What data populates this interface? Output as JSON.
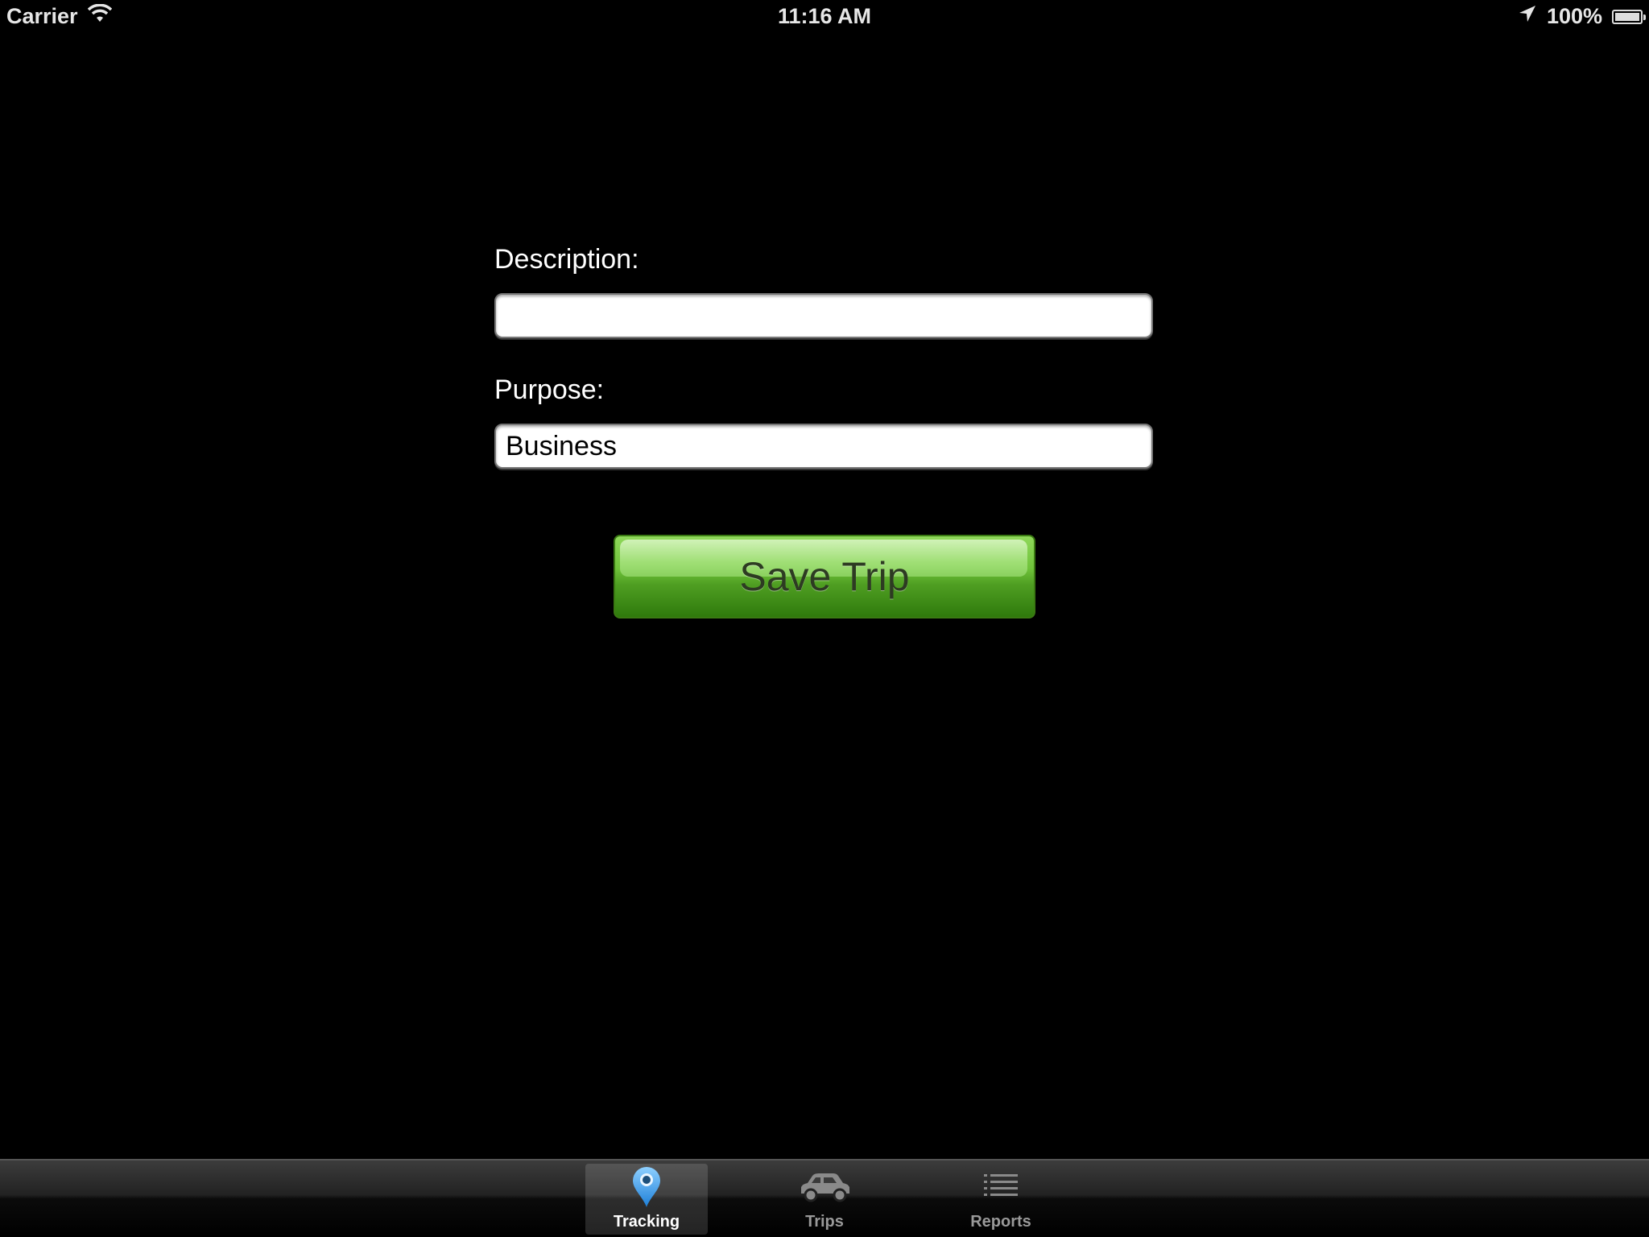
{
  "status_bar": {
    "carrier": "Carrier",
    "time": "11:16 AM",
    "battery": "100%",
    "icons": [
      "wifi-icon",
      "location-arrow-icon",
      "battery-icon"
    ]
  },
  "form": {
    "description_label": "Description:",
    "description_value": "",
    "purpose_label": "Purpose:",
    "purpose_value": "Business"
  },
  "save_button": {
    "label": "Save Trip",
    "color": "#4f9e22"
  },
  "tab_bar": {
    "tabs": [
      {
        "label": "Tracking",
        "icon": "map-pin-icon",
        "selected": true
      },
      {
        "label": "Trips",
        "icon": "car-icon",
        "selected": false
      },
      {
        "label": "Reports",
        "icon": "list-icon",
        "selected": false
      }
    ],
    "accent_color": "#3a9be8"
  }
}
